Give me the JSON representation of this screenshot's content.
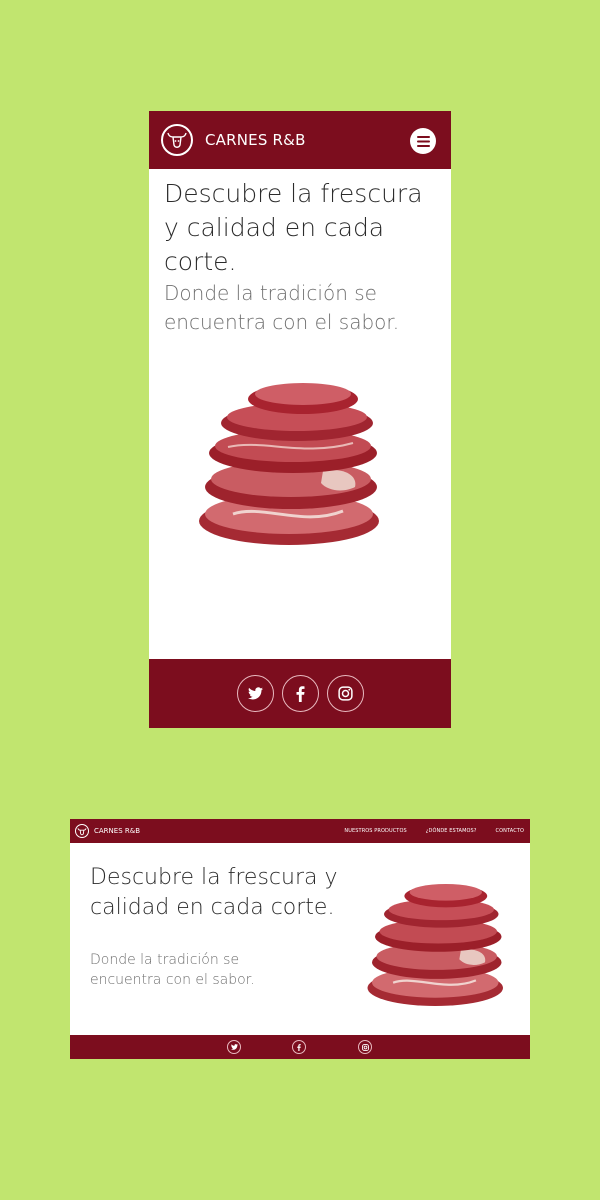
{
  "brand": {
    "name": "CARNES R&B",
    "logo_icon": "bull-head-icon"
  },
  "hero": {
    "headline": "Descubre la frescura y calidad en cada corte.",
    "subheadline": "Donde la tradición se encuentra con el sabor."
  },
  "nav": {
    "items": [
      {
        "label": "NUESTROS PRODUCTOS"
      },
      {
        "label": "¿DÓNDE ESTAMOS?"
      },
      {
        "label": "CONTACTO"
      }
    ],
    "menu_icon": "hamburger-menu-icon"
  },
  "social": [
    {
      "icon": "twitter-icon"
    },
    {
      "icon": "facebook-icon"
    },
    {
      "icon": "instagram-icon"
    }
  ],
  "colors": {
    "background": "#c1e56f",
    "brand": "#7c0d1e",
    "surface": "#ffffff",
    "text": "#2b2b2b",
    "muted_text": "#6f6f6f"
  }
}
